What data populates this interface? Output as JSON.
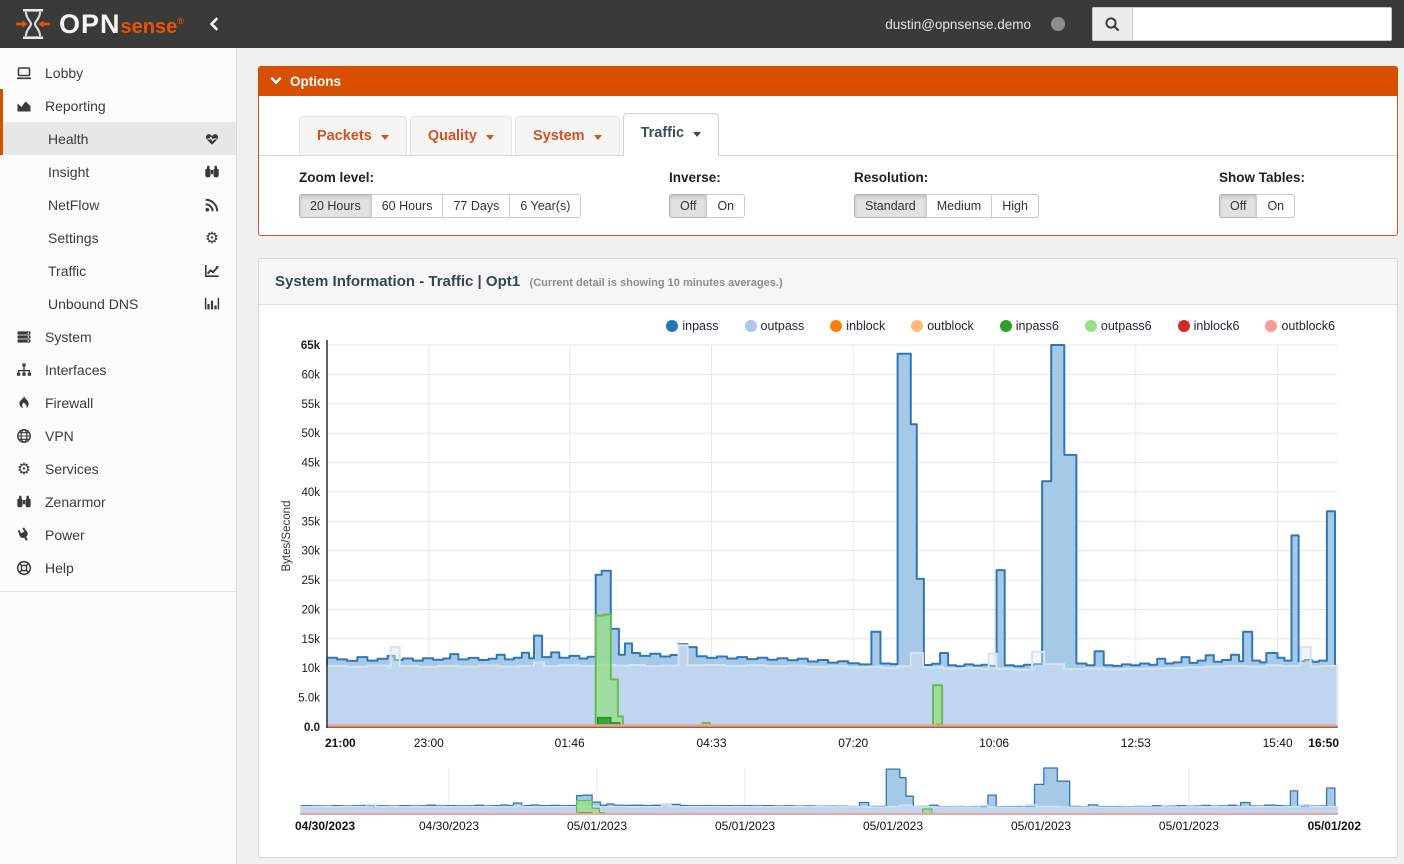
{
  "topbar": {
    "brand_opn": "OPN",
    "brand_sense": "sense",
    "brand_reg": "®",
    "user": "dustin@opnsense.demo",
    "search_placeholder": ""
  },
  "sidebar": {
    "items": [
      {
        "label": "Lobby",
        "icon": "laptop-icon"
      },
      {
        "label": "Reporting",
        "icon": "area-chart-icon",
        "parent_active": true,
        "children": [
          {
            "label": "Health",
            "icon": "heartbeat-icon",
            "active": true
          },
          {
            "label": "Insight",
            "icon": "binoculars-icon"
          },
          {
            "label": "NetFlow",
            "icon": "rss-icon"
          },
          {
            "label": "Settings",
            "icon": "gear-icon"
          },
          {
            "label": "Traffic",
            "icon": "line-chart-icon"
          },
          {
            "label": "Unbound DNS",
            "icon": "bar-chart-icon"
          }
        ]
      },
      {
        "label": "System",
        "icon": "server-icon"
      },
      {
        "label": "Interfaces",
        "icon": "sitemap-icon"
      },
      {
        "label": "Firewall",
        "icon": "fire-icon"
      },
      {
        "label": "VPN",
        "icon": "globe-icon"
      },
      {
        "label": "Services",
        "icon": "gear-icon"
      },
      {
        "label": "Zenarmor",
        "icon": "binoculars-icon"
      },
      {
        "label": "Power",
        "icon": "plug-icon"
      },
      {
        "label": "Help",
        "icon": "life-ring-icon"
      }
    ]
  },
  "options": {
    "title": "Options",
    "tabs": [
      {
        "label": "Packets",
        "active": false
      },
      {
        "label": "Quality",
        "active": false
      },
      {
        "label": "System",
        "active": false
      },
      {
        "label": "Traffic",
        "active": true
      }
    ],
    "controls": [
      {
        "label": "Zoom level:",
        "buttons": [
          {
            "label": "20 Hours",
            "active": true
          },
          {
            "label": "60 Hours",
            "active": false
          },
          {
            "label": "77 Days",
            "active": false
          },
          {
            "label": "6 Year(s)",
            "active": false
          }
        ]
      },
      {
        "label": "Inverse:",
        "buttons": [
          {
            "label": "Off",
            "active": true
          },
          {
            "label": "On",
            "active": false
          }
        ]
      },
      {
        "label": "Resolution:",
        "buttons": [
          {
            "label": "Standard",
            "active": true
          },
          {
            "label": "Medium",
            "active": false
          },
          {
            "label": "High",
            "active": false
          }
        ]
      },
      {
        "label": "Show Tables:",
        "buttons": [
          {
            "label": "Off",
            "active": true
          },
          {
            "label": "On",
            "active": false
          }
        ]
      }
    ]
  },
  "panel": {
    "title": "System Information - Traffic | Opt1",
    "subtitle": "(Current detail is showing 10 minutes averages.)"
  },
  "chart_data": {
    "type": "area",
    "title": "System Information - Traffic | Opt1",
    "ylabel": "Bytes/Second",
    "ylim": [
      0,
      65000
    ],
    "grid": true,
    "legend_position": "top-right",
    "y_ticks": [
      "0.0",
      "5.0k",
      "10k",
      "15k",
      "20k",
      "25k",
      "30k",
      "35k",
      "40k",
      "45k",
      "50k",
      "55k",
      "60k",
      "65k"
    ],
    "x_ticks": [
      {
        "f": 0.0,
        "label": "21:00",
        "bold": true
      },
      {
        "f": 0.1008,
        "label": "23:00",
        "bold": false
      },
      {
        "f": 0.2403,
        "label": "01:46",
        "bold": false
      },
      {
        "f": 0.3807,
        "label": "04:33",
        "bold": false
      },
      {
        "f": 0.521,
        "label": "07:20",
        "bold": false
      },
      {
        "f": 0.6605,
        "label": "10:06",
        "bold": false
      },
      {
        "f": 0.8008,
        "label": "12:53",
        "bold": false
      },
      {
        "f": 0.9412,
        "label": "15:40",
        "bold": false
      },
      {
        "f": 1.0,
        "label": "16:50",
        "bold": true
      }
    ],
    "mini_x_ticks": [
      {
        "f": 0.0,
        "label": "04/30/2023",
        "bold": true
      },
      {
        "f": 0.1429,
        "label": "04/30/2023",
        "bold": false
      },
      {
        "f": 0.2857,
        "label": "05/01/2023",
        "bold": false
      },
      {
        "f": 0.4286,
        "label": "05/01/2023",
        "bold": false
      },
      {
        "f": 0.5714,
        "label": "05/01/2023",
        "bold": false
      },
      {
        "f": 0.7143,
        "label": "05/01/2023",
        "bold": false
      },
      {
        "f": 0.8571,
        "label": "05/01/2023",
        "bold": false
      },
      {
        "f": 1.0,
        "label": "05/01/202",
        "bold": true
      }
    ],
    "legend": [
      {
        "name": "inpass",
        "color": "#1f77b4"
      },
      {
        "name": "outpass",
        "color": "#aec7e8"
      },
      {
        "name": "inblock",
        "color": "#ff7f0e"
      },
      {
        "name": "outblock",
        "color": "#ffbb78"
      },
      {
        "name": "inpass6",
        "color": "#2ca02c"
      },
      {
        "name": "outpass6",
        "color": "#98df8a"
      },
      {
        "name": "inblock6",
        "color": "#d62728"
      },
      {
        "name": "outblock6",
        "color": "#ff9896"
      }
    ],
    "series": [
      {
        "name": "inpass",
        "render": "area",
        "stroke": "#2e79b5",
        "stroke_width": 2,
        "fill": "#a6c9e8",
        "fill_opacity": 1,
        "points": [
          [
            0,
            11800
          ],
          [
            0.01,
            11500
          ],
          [
            0.02,
            11250
          ],
          [
            0.03,
            11900
          ],
          [
            0.04,
            11300
          ],
          [
            0.05,
            11600
          ],
          [
            0.06,
            12100
          ],
          [
            0.067,
            11400
          ],
          [
            0.075,
            11650
          ],
          [
            0.085,
            11300
          ],
          [
            0.095,
            11700
          ],
          [
            0.105,
            11450
          ],
          [
            0.115,
            11650
          ],
          [
            0.122,
            12400
          ],
          [
            0.13,
            11500
          ],
          [
            0.14,
            11750
          ],
          [
            0.15,
            11400
          ],
          [
            0.16,
            11600
          ],
          [
            0.168,
            12300
          ],
          [
            0.176,
            11500
          ],
          [
            0.185,
            11800
          ],
          [
            0.193,
            12650
          ],
          [
            0.2,
            11700
          ],
          [
            0.205,
            15550
          ],
          [
            0.213,
            11900
          ],
          [
            0.222,
            12700
          ],
          [
            0.23,
            11800
          ],
          [
            0.24,
            12100
          ],
          [
            0.25,
            11650
          ],
          [
            0.258,
            11950
          ],
          [
            0.266,
            25900
          ],
          [
            0.272,
            26600
          ],
          [
            0.281,
            16700
          ],
          [
            0.289,
            12300
          ],
          [
            0.295,
            14200
          ],
          [
            0.302,
            12600
          ],
          [
            0.31,
            12100
          ],
          [
            0.32,
            12450
          ],
          [
            0.33,
            12000
          ],
          [
            0.34,
            12250
          ],
          [
            0.348,
            14100
          ],
          [
            0.357,
            13600
          ],
          [
            0.366,
            12050
          ],
          [
            0.376,
            11750
          ],
          [
            0.386,
            12000
          ],
          [
            0.396,
            11650
          ],
          [
            0.406,
            11900
          ],
          [
            0.416,
            11550
          ],
          [
            0.426,
            11800
          ],
          [
            0.436,
            11450
          ],
          [
            0.446,
            11700
          ],
          [
            0.456,
            11350
          ],
          [
            0.466,
            11600
          ],
          [
            0.476,
            11150
          ],
          [
            0.486,
            11400
          ],
          [
            0.496,
            10950
          ],
          [
            0.506,
            11200
          ],
          [
            0.516,
            10850
          ],
          [
            0.527,
            10650
          ],
          [
            0.539,
            16200
          ],
          [
            0.548,
            10800
          ],
          [
            0.558,
            10700
          ],
          [
            0.565,
            63500
          ],
          [
            0.578,
            51500
          ],
          [
            0.584,
            25200
          ],
          [
            0.591,
            10550
          ],
          [
            0.599,
            10750
          ],
          [
            0.607,
            12600
          ],
          [
            0.615,
            10500
          ],
          [
            0.623,
            10350
          ],
          [
            0.631,
            10650
          ],
          [
            0.64,
            10450
          ],
          [
            0.648,
            10600
          ],
          [
            0.655,
            10400
          ],
          [
            0.663,
            26700
          ],
          [
            0.671,
            10500
          ],
          [
            0.68,
            10350
          ],
          [
            0.69,
            10600
          ],
          [
            0.7,
            10700
          ],
          [
            0.708,
            41800
          ],
          [
            0.717,
            65500
          ],
          [
            0.73,
            46300
          ],
          [
            0.742,
            10800
          ],
          [
            0.752,
            10500
          ],
          [
            0.76,
            12900
          ],
          [
            0.769,
            10500
          ],
          [
            0.778,
            10400
          ],
          [
            0.787,
            10650
          ],
          [
            0.796,
            10500
          ],
          [
            0.805,
            10800
          ],
          [
            0.814,
            10600
          ],
          [
            0.822,
            11600
          ],
          [
            0.83,
            10800
          ],
          [
            0.838,
            11000
          ],
          [
            0.846,
            11900
          ],
          [
            0.854,
            10900
          ],
          [
            0.862,
            11300
          ],
          [
            0.87,
            12200
          ],
          [
            0.878,
            11100
          ],
          [
            0.886,
            11400
          ],
          [
            0.895,
            12300
          ],
          [
            0.903,
            11200
          ],
          [
            0.907,
            16200
          ],
          [
            0.916,
            11300
          ],
          [
            0.924,
            11000
          ],
          [
            0.93,
            12600
          ],
          [
            0.941,
            11800
          ],
          [
            0.948,
            11300
          ],
          [
            0.955,
            32600
          ],
          [
            0.962,
            11200
          ],
          [
            0.968,
            11400
          ],
          [
            0.975,
            11100
          ],
          [
            0.982,
            11300
          ],
          [
            0.99,
            36700
          ],
          [
            0.998,
            10400
          ],
          [
            1,
            10300
          ]
        ]
      },
      {
        "name": "outpass",
        "render": "area",
        "stroke": "#d5e3f3",
        "stroke_width": 2,
        "fill": "#dcE9f6",
        "fill_opacity": 0.45,
        "points": [
          [
            0,
            10400
          ],
          [
            0.02,
            10250
          ],
          [
            0.04,
            10450
          ],
          [
            0.06,
            10300
          ],
          [
            0.063,
            13600
          ],
          [
            0.072,
            10400
          ],
          [
            0.09,
            10250
          ],
          [
            0.11,
            10400
          ],
          [
            0.13,
            10300
          ],
          [
            0.15,
            10450
          ],
          [
            0.17,
            10300
          ],
          [
            0.19,
            10400
          ],
          [
            0.205,
            11000
          ],
          [
            0.215,
            10350
          ],
          [
            0.23,
            10500
          ],
          [
            0.25,
            10400
          ],
          [
            0.266,
            10600
          ],
          [
            0.285,
            10450
          ],
          [
            0.3,
            10550
          ],
          [
            0.315,
            10350
          ],
          [
            0.33,
            10450
          ],
          [
            0.348,
            13900
          ],
          [
            0.357,
            10500
          ],
          [
            0.375,
            10550
          ],
          [
            0.395,
            10400
          ],
          [
            0.415,
            10500
          ],
          [
            0.435,
            10350
          ],
          [
            0.455,
            10450
          ],
          [
            0.475,
            10250
          ],
          [
            0.495,
            10350
          ],
          [
            0.515,
            10150
          ],
          [
            0.535,
            10250
          ],
          [
            0.55,
            10050
          ],
          [
            0.565,
            10350
          ],
          [
            0.578,
            12600
          ],
          [
            0.59,
            10150
          ],
          [
            0.61,
            9950
          ],
          [
            0.63,
            10050
          ],
          [
            0.648,
            9850
          ],
          [
            0.655,
            12500
          ],
          [
            0.663,
            9900
          ],
          [
            0.68,
            9750
          ],
          [
            0.698,
            12800
          ],
          [
            0.71,
            10700
          ],
          [
            0.73,
            9850
          ],
          [
            0.75,
            9950
          ],
          [
            0.77,
            9800
          ],
          [
            0.79,
            9900
          ],
          [
            0.81,
            9950
          ],
          [
            0.83,
            10050
          ],
          [
            0.85,
            10200
          ],
          [
            0.87,
            10300
          ],
          [
            0.89,
            10400
          ],
          [
            0.91,
            10300
          ],
          [
            0.93,
            10500
          ],
          [
            0.945,
            10400
          ],
          [
            0.964,
            13600
          ],
          [
            0.974,
            10300
          ],
          [
            0.985,
            10400
          ],
          [
            1,
            10250
          ]
        ]
      },
      {
        "name": "inblock",
        "render": "line",
        "stroke": "#ff7f0e",
        "stroke_width": 1,
        "points": [
          [
            0,
            0
          ],
          [
            1,
            0
          ]
        ]
      },
      {
        "name": "outblock",
        "render": "line",
        "stroke": "#ffbb78",
        "stroke_width": 1,
        "points": [
          [
            0,
            0
          ],
          [
            1,
            0
          ]
        ]
      },
      {
        "name": "outpass6",
        "render": "area",
        "stroke": "#66bb55",
        "stroke_width": 2,
        "fill": "#98df8a",
        "fill_opacity": 0.78,
        "points": [
          [
            0,
            0
          ],
          [
            0.262,
            0
          ],
          [
            0.266,
            18950
          ],
          [
            0.274,
            19150
          ],
          [
            0.281,
            8100
          ],
          [
            0.288,
            1800
          ],
          [
            0.293,
            0
          ],
          [
            0.368,
            0
          ],
          [
            0.372,
            700
          ],
          [
            0.379,
            0
          ],
          [
            0.597,
            0
          ],
          [
            0.6,
            7100
          ],
          [
            0.609,
            0
          ],
          [
            1,
            0
          ]
        ]
      },
      {
        "name": "inpass6",
        "render": "area",
        "stroke": "#2c8f2b",
        "stroke_width": 1.5,
        "fill": "#35a233",
        "fill_opacity": 0.95,
        "points": [
          [
            0,
            0
          ],
          [
            0.266,
            0
          ],
          [
            0.268,
            1600
          ],
          [
            0.281,
            700
          ],
          [
            0.29,
            0
          ],
          [
            0.6,
            0
          ],
          [
            0.603,
            400
          ],
          [
            0.609,
            0
          ],
          [
            1,
            0
          ]
        ]
      },
      {
        "name": "inblock6",
        "render": "line",
        "stroke": "#d62728",
        "stroke_width": 1.2,
        "points": [
          [
            0,
            60
          ],
          [
            1,
            60
          ]
        ]
      },
      {
        "name": "outblock6",
        "render": "line",
        "stroke": "#ff9896",
        "stroke_width": 2.5,
        "points": [
          [
            0,
            260
          ],
          [
            1,
            260
          ]
        ]
      }
    ]
  }
}
